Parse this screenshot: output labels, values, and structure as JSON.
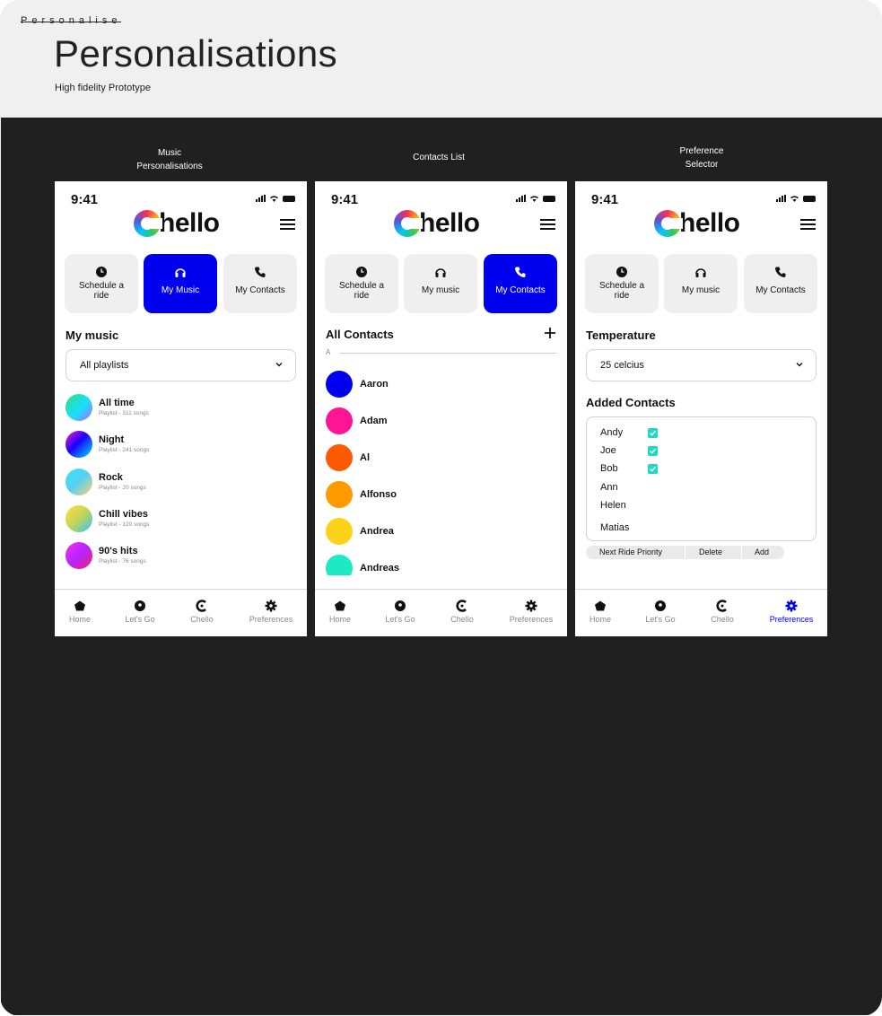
{
  "header": {
    "kicker": "Personalise",
    "title": "Personalisations",
    "subtitle": "High fidelity Prototype"
  },
  "frames": [
    {
      "label_line1": "Music",
      "label_line2": "Personalisations"
    },
    {
      "label_line1": "Contacts List",
      "label_line2": ""
    },
    {
      "label_line1": "Preference",
      "label_line2": "Selector"
    }
  ],
  "status_time": "9:41",
  "logo_text": "hello",
  "tiles": {
    "schedule": "Schedule a ride",
    "music_frame1": "My Music",
    "music": "My music",
    "contacts": "My Contacts"
  },
  "nav": {
    "home": "Home",
    "letsgo": "Let's Go",
    "chello": "Chello",
    "preferences": "Preferences"
  },
  "music": {
    "section_title": "My music",
    "select_value": "All playlists",
    "playlists": [
      {
        "name": "All time",
        "meta": "Playlist - 311 songs"
      },
      {
        "name": "Night",
        "meta": "Playlist - 241 songs"
      },
      {
        "name": "Rock",
        "meta": "Playlist - 20 songs"
      },
      {
        "name": "Chill vibes",
        "meta": "Playlist - 120 songs"
      },
      {
        "name": "90's hits",
        "meta": "Playlist - 76 songs"
      }
    ]
  },
  "contacts": {
    "section_title": "All Contacts",
    "index_letter": "A",
    "items": [
      {
        "name": "Aaron",
        "color": "#0000ee"
      },
      {
        "name": "Adam",
        "color": "#ff1493"
      },
      {
        "name": "Al",
        "color": "#ff5a00"
      },
      {
        "name": "Alfonso",
        "color": "#ff9a00"
      },
      {
        "name": "Andrea",
        "color": "#ffd21a"
      },
      {
        "name": "Andreas",
        "color": "#1de9c4"
      }
    ]
  },
  "preferences": {
    "temperature_title": "Temperature",
    "temperature_value": "25 celcius",
    "added_title": "Added Contacts",
    "added": [
      {
        "name": "Andy",
        "checked": true
      },
      {
        "name": "Joe",
        "checked": true
      },
      {
        "name": "Bob",
        "checked": true
      },
      {
        "name": "Ann",
        "checked": false
      },
      {
        "name": "Helen",
        "checked": false
      },
      {
        "name": "Matias",
        "checked": false
      }
    ],
    "actions": {
      "priority": "Next Ride Priority",
      "delete": "Delete",
      "add": "Add"
    }
  },
  "colors": {
    "accent": "#0000ee",
    "check": "#21d8c6",
    "canvas": "#202020"
  }
}
